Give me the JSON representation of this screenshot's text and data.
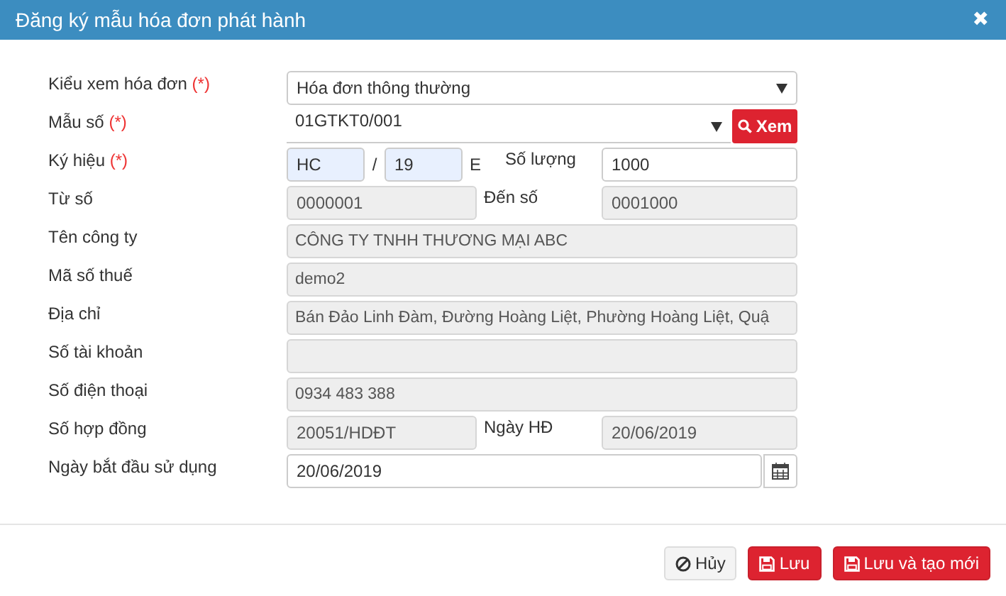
{
  "window": {
    "title": "Đăng ký mẫu hóa đơn phát hành",
    "close": "✖"
  },
  "rows": [
    {
      "kind": "select",
      "label": "Kiểu xem hóa đơn",
      "required_mark": "(*)",
      "value": "Hóa đơn thông thường"
    },
    {
      "kind": "select-button",
      "label": "Mẫu số",
      "required_mark": "(*)",
      "value": "01GTKT0/001",
      "button": "Xem"
    },
    {
      "kind": "symbol",
      "label": "Ký hiệu",
      "required_mark": "(*)",
      "parts": [
        {
          "value": "HC",
          "autofilled": true
        },
        {
          "value": "19",
          "autofilled": true
        }
      ],
      "separator": "/",
      "suffix": "E",
      "label2": "Số lượng",
      "value2": "1000",
      "disabled2": false
    },
    {
      "kind": "pair",
      "label": "Từ số",
      "value": "0000001",
      "disabled": true,
      "label2": "Đến số",
      "value2": "0001000",
      "disabled2": true
    },
    {
      "kind": "text",
      "label": "Tên công ty",
      "value": "CÔNG TY TNHH THƯƠNG MẠI ABC",
      "disabled": true
    },
    {
      "kind": "text",
      "label": "Mã số thuế",
      "value": "demo2",
      "disabled": true
    },
    {
      "kind": "text",
      "label": "Địa chỉ",
      "value": " Bán Đảo Linh Đàm, Đường Hoàng Liệt, Phường Hoàng Liệt, Quậ",
      "disabled": true
    },
    {
      "kind": "text",
      "label": "Số tài khoản",
      "disabled": true
    },
    {
      "kind": "text",
      "label": "Số điện thoại",
      "value": "0934 483 388",
      "disabled": true
    },
    {
      "kind": "pair",
      "label": "Số hợp đồng",
      "value": "20051/HDĐT",
      "disabled": true,
      "label2": "Ngày HĐ",
      "value2": "20/06/2019",
      "disabled2": true
    },
    {
      "kind": "date",
      "label": "Ngày bắt đầu sử dụng",
      "value": "20/06/2019",
      "disabled": false
    }
  ],
  "buttons": [
    {
      "label": "Hủy",
      "kind": "default"
    },
    {
      "label": "Lưu",
      "kind": "danger"
    },
    {
      "label": "Lưu và tạo mới",
      "kind": "danger"
    }
  ]
}
